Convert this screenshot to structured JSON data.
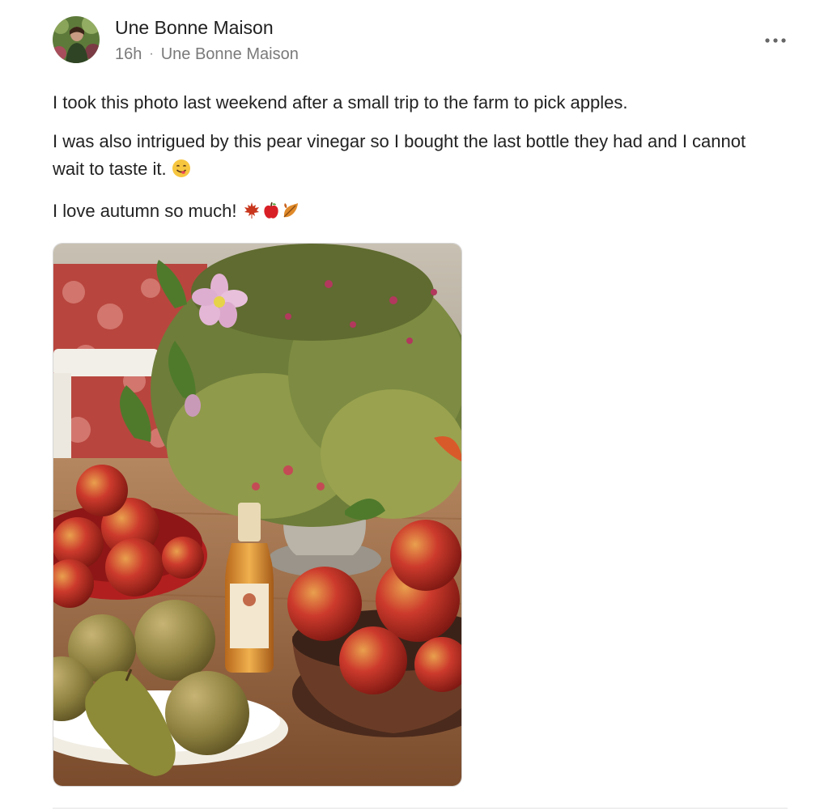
{
  "post": {
    "author": "Une Bonne Maison",
    "timestamp": "16h",
    "separator": "·",
    "publication": "Une Bonne Maison",
    "paragraphs": [
      "I took this photo last weekend after a small trip to the farm to pick apples.",
      "I was also intrigued by this pear vinegar so I bought the last bottle they had and I cannot wait to taste it.",
      "I love autumn so much!"
    ],
    "emoji": {
      "paragraph2": "savoring-food-face-icon",
      "paragraph3": [
        "maple-leaf-icon",
        "red-apple-icon",
        "fallen-leaf-icon"
      ]
    },
    "more_menu_icon": "ellipsis-icon"
  },
  "colors": {
    "text": "#222222",
    "meta": "#7a7a7a",
    "divider": "#e2e2e2"
  }
}
